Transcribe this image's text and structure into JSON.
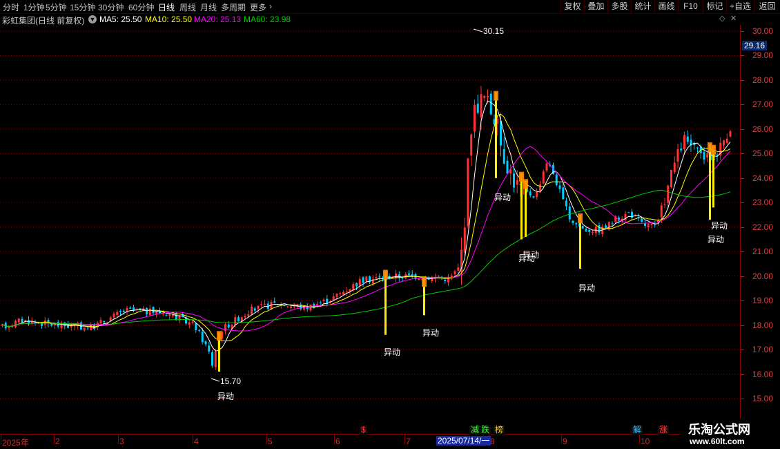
{
  "toolbar": {
    "periods": [
      {
        "label": "分时",
        "active": false
      },
      {
        "label": "1分钟",
        "active": false
      },
      {
        "label": "5分钟",
        "active": false
      },
      {
        "label": "15分钟",
        "active": false
      },
      {
        "label": "30分钟",
        "active": false
      },
      {
        "label": "60分钟",
        "active": false
      },
      {
        "label": "日线",
        "active": true
      },
      {
        "label": "周线",
        "active": false
      },
      {
        "label": "月线",
        "active": false
      },
      {
        "label": "多周期",
        "active": false
      },
      {
        "label": "更多",
        "active": false
      }
    ],
    "more_arrow": "›",
    "buttons": [
      "复权",
      "叠加",
      "多股",
      "统计",
      "画线",
      "F10",
      "标记",
      "+自选",
      "返回"
    ]
  },
  "info": {
    "title": "彩虹集团(日线 前复权)",
    "ma5": "MA5: 25.50",
    "ma10": "MA10: 25.50",
    "ma20": "MA20: 25.13",
    "ma60": "MA60: 23.98"
  },
  "colors": {
    "up": "#ff3333",
    "down": "#00ccff",
    "ma5": "#ffffff",
    "ma10": "#ffff00",
    "ma20": "#ff00ff",
    "ma60": "#00cc00",
    "signal": "#ffee00",
    "grid": "#8b0000"
  },
  "price_axis": {
    "ticks": [
      "30.00",
      "29.00",
      "28.00",
      "27.00",
      "26.00",
      "25.00",
      "24.00",
      "23.00",
      "22.00",
      "21.00",
      "20.00",
      "19.00",
      "18.00",
      "17.00",
      "16.00",
      "15.00"
    ],
    "last_price": "29.16"
  },
  "chart_data": {
    "type": "candlestick",
    "high_label": "30.15",
    "low_label": "15.70",
    "signal_label": "异动",
    "ylim": [
      14.6,
      30.3
    ]
  },
  "date_axis": {
    "labels": [
      "2025年",
      "2",
      "3",
      "4",
      "5",
      "6",
      "7",
      "8",
      "9",
      "10"
    ],
    "cursor_date": "2025/07/14/一",
    "tags": [
      {
        "text": "$",
        "color": "#ff3030"
      },
      {
        "text": "减",
        "color": "#40ff40"
      },
      {
        "text": "跌",
        "color": "#40ff40"
      },
      {
        "text": "榜",
        "color": "#ffcc00"
      },
      {
        "text": "解",
        "color": "#40c0ff"
      },
      {
        "text": "涨",
        "color": "#ff4040"
      }
    ]
  },
  "watermark": {
    "title": "乐淘公式网",
    "url": "www.60lt.com"
  }
}
